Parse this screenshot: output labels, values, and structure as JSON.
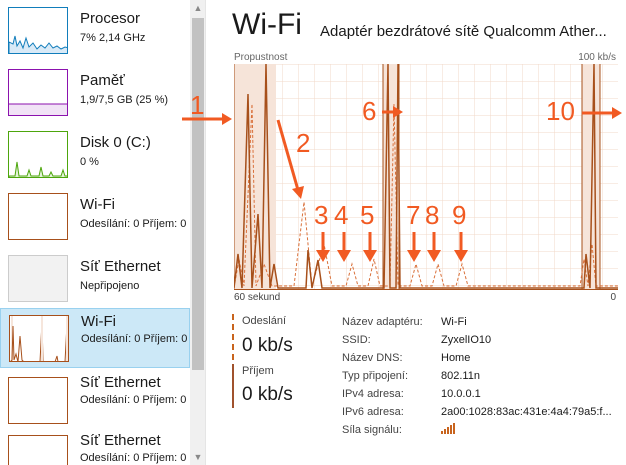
{
  "sidebar": {
    "items": [
      {
        "title": "Procesor",
        "subtitle": "7% 2,14 GHz",
        "color": "#117dbb"
      },
      {
        "title": "Paměť",
        "subtitle": "1,9/7,5 GB (25 %)",
        "color": "#8b12ae"
      },
      {
        "title": "Disk 0 (C:)",
        "subtitle": "0 %",
        "color": "#4da60c"
      },
      {
        "title": "Wi-Fi",
        "subtitle": "Odesílání: 0 Příjem: 0",
        "color": "#a7501b"
      },
      {
        "title": "Síť Ethernet",
        "subtitle": "Nepřipojeno",
        "color": "#cccccc"
      },
      {
        "title": "Wi-Fi",
        "subtitle": "Odesílání: 0 Příjem: 0",
        "color": "#a7501b"
      },
      {
        "title": "Síť Ethernet",
        "subtitle": "Odesílání: 0 Příjem: 0",
        "color": "#a7501b"
      },
      {
        "title": "Síť Ethernet",
        "subtitle": "Odesílání: 0 Příjem: 0",
        "color": "#a7501b"
      }
    ]
  },
  "main": {
    "title": "Wi-Fi",
    "adapter": "Adaptér bezdrátové sítě Qualcomm Ather...",
    "throughput_label": "Propustnost",
    "max_label": "100 kb/s",
    "time_label": "60 sekund",
    "zero_label": "0"
  },
  "stats": {
    "send_label": "Odeslání",
    "send_value": "0 kb/s",
    "recv_label": "Příjem",
    "recv_value": "0 kb/s"
  },
  "properties": [
    {
      "label": "Název adaptéru:",
      "value": "Wi-Fi"
    },
    {
      "label": "SSID:",
      "value": "ZyxelIO10"
    },
    {
      "label": "Název DNS:",
      "value": "Home"
    },
    {
      "label": "Typ připojení:",
      "value": "802.11n"
    },
    {
      "label": "IPv4 adresa:",
      "value": "10.0.0.1"
    },
    {
      "label": "IPv6 adresa:",
      "value": "2a00:1028:83ac:431e:4a4:79a5:f..."
    },
    {
      "label": "Síla signálu:",
      "value": ""
    }
  ],
  "annotations": [
    "1",
    "2",
    "3",
    "4",
    "5",
    "6",
    "7",
    "8",
    "9",
    "10"
  ],
  "colors": {
    "accent": "#a7501b",
    "annotation": "#f15a22",
    "grid": "#f2d9c8"
  },
  "icons": [
    "signal-strength-icon",
    "arrow-icon"
  ]
}
